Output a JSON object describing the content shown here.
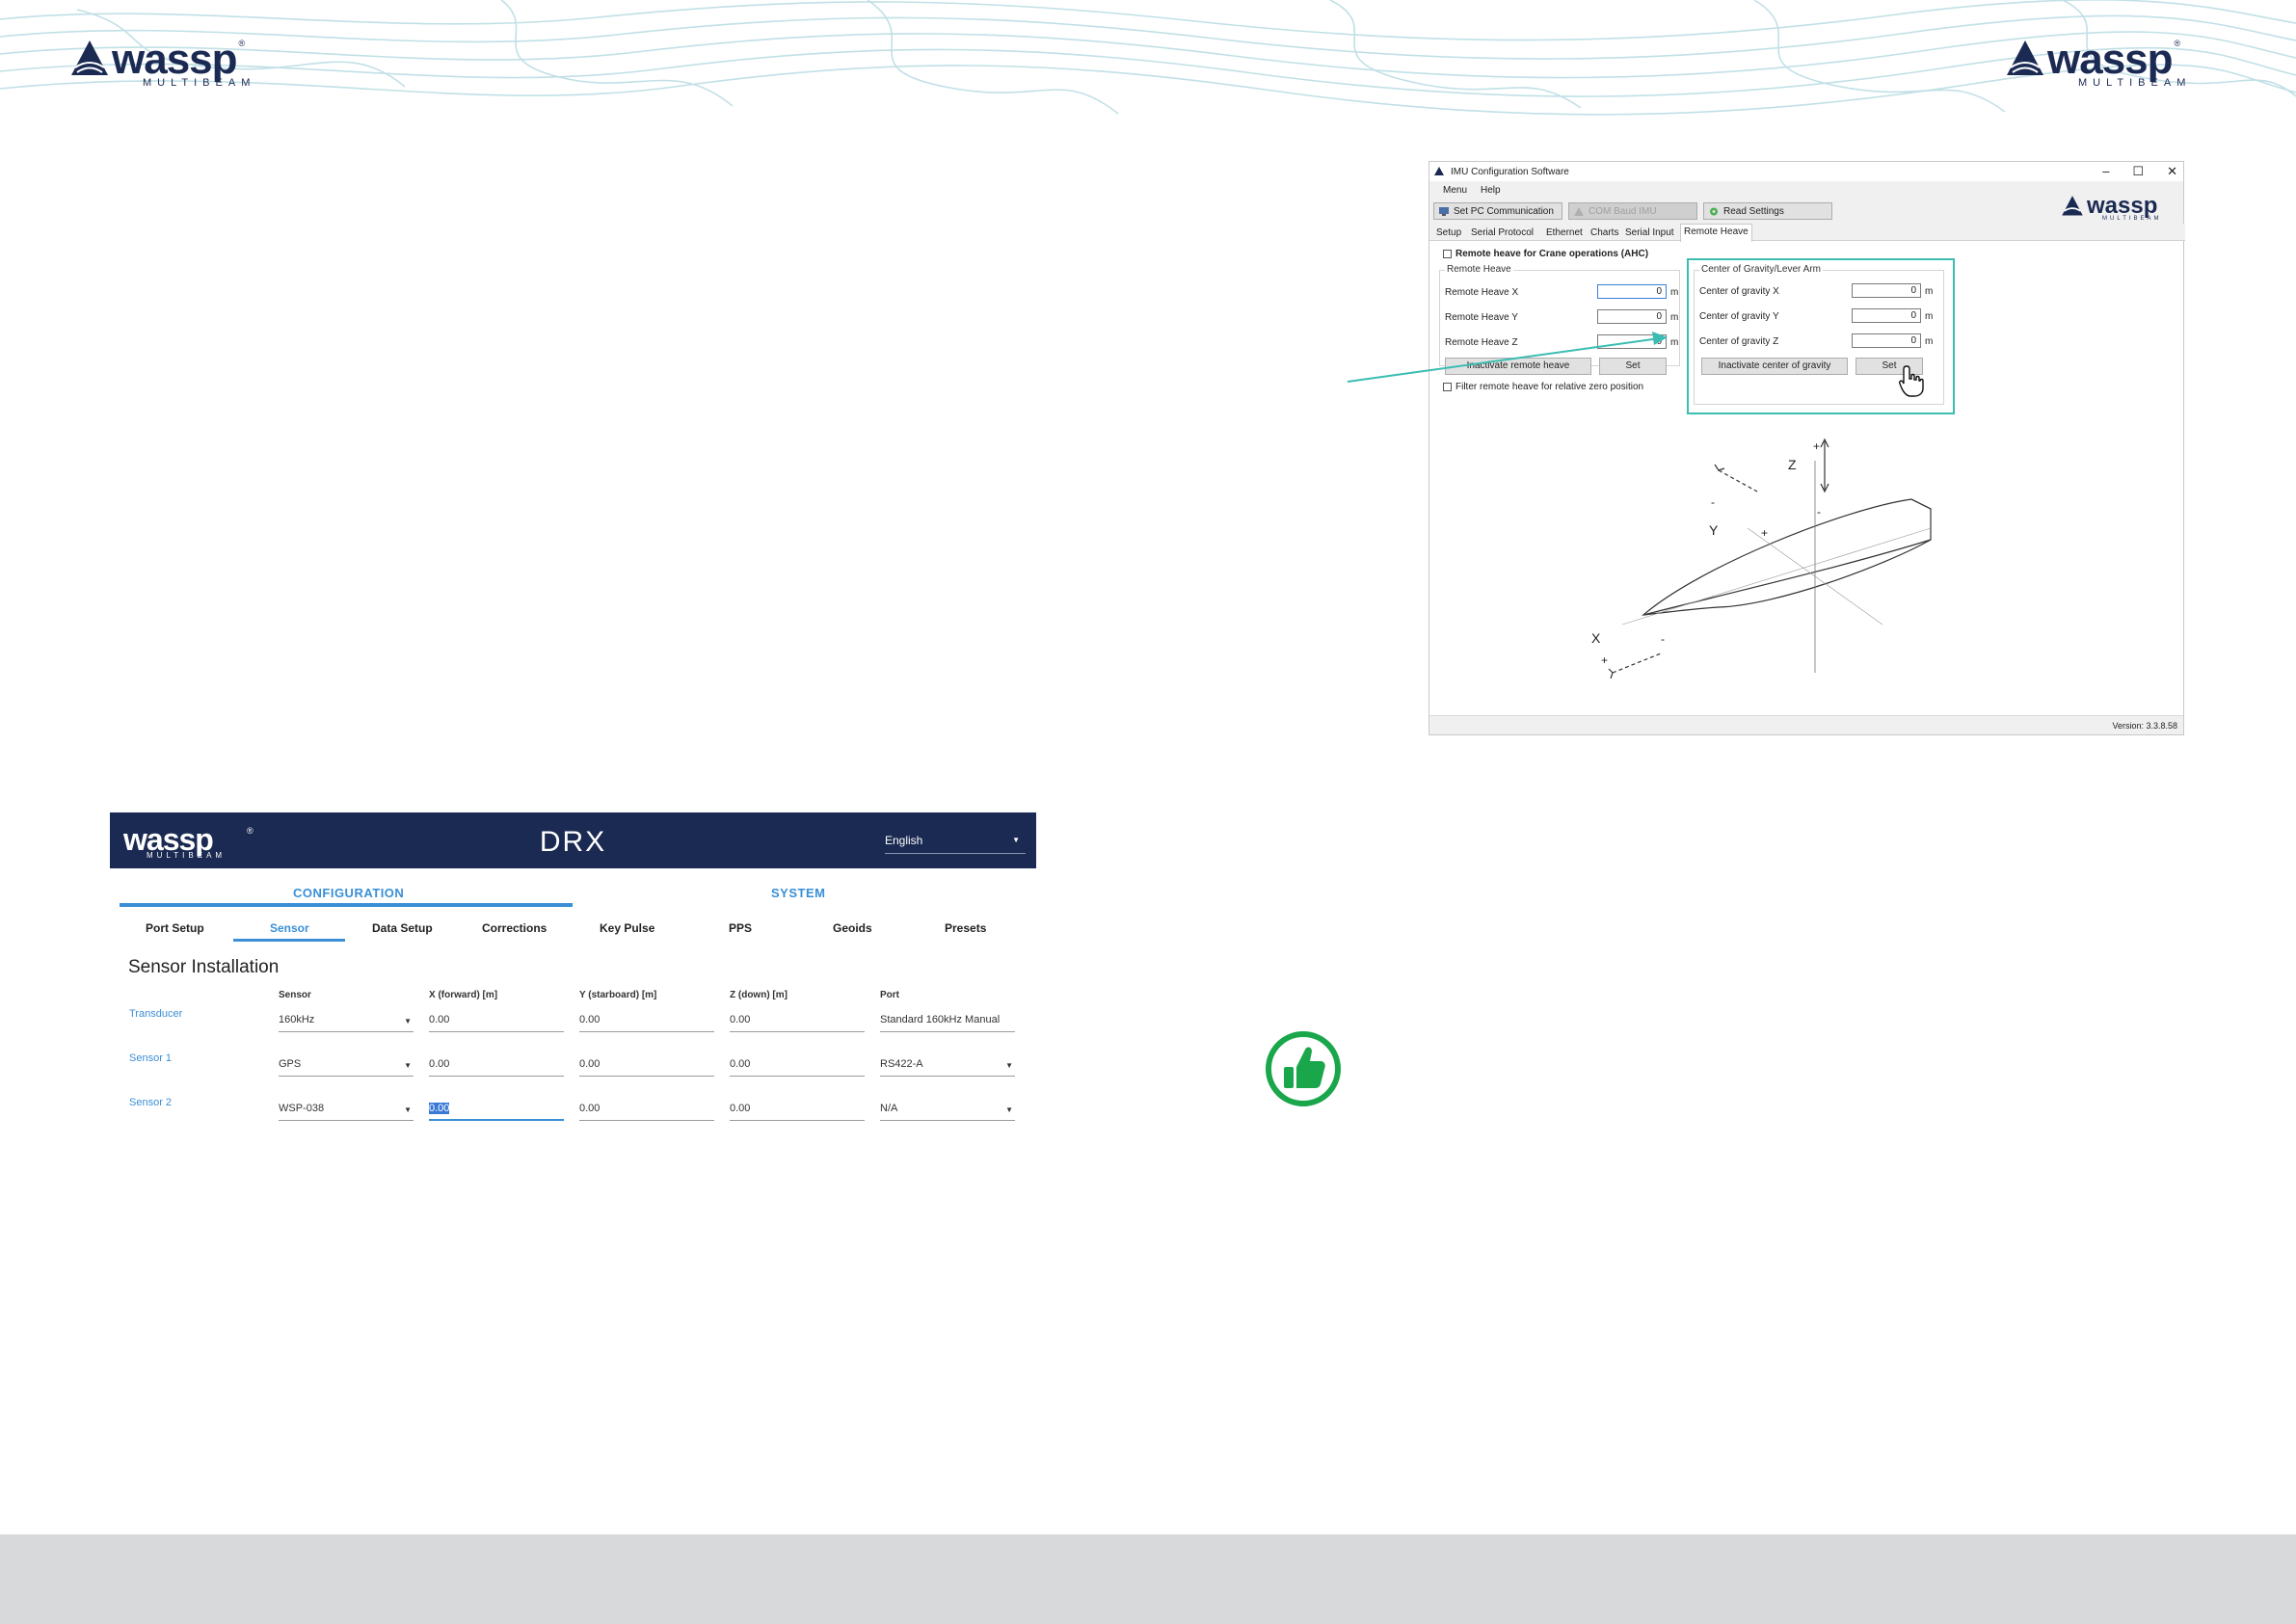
{
  "header": {
    "logo_word": "wassp",
    "logo_sub": "MULTIBEAM",
    "logo_reg": "®"
  },
  "imu_window": {
    "title": "IMU Configuration Software",
    "controls": {
      "minimize": "–",
      "maximize": "☐",
      "close": "✕"
    },
    "menu": [
      "Menu",
      "Help"
    ],
    "toolbar": {
      "set_pc": "Set PC Communication",
      "com_baud": "COM Baud IMU",
      "read_settings": "Read Settings"
    },
    "brand": {
      "word": "wassp",
      "sub": "MULTIBEAM"
    },
    "tabs": [
      "Setup",
      "Serial Protocol",
      "Ethernet",
      "Charts",
      "Serial Input",
      "Remote Heave"
    ],
    "active_tab": "Remote Heave",
    "ahc_checkbox": "Remote heave for Crane operations (AHC)",
    "remote_heave": {
      "title": "Remote Heave",
      "rows": [
        {
          "label": "Remote Heave X",
          "value": "0",
          "unit": "m"
        },
        {
          "label": "Remote Heave Y",
          "value": "0",
          "unit": "m"
        },
        {
          "label": "Remote Heave Z",
          "value": "0",
          "unit": "m"
        }
      ],
      "inactivate_button": "Inactivate remote heave",
      "set_button": "Set",
      "filter_checkbox": "Filter remote heave for relative zero position"
    },
    "center_of_gravity": {
      "title": "Center of Gravity/Lever Arm",
      "rows": [
        {
          "label": "Center of gravity X",
          "value": "0",
          "unit": "m"
        },
        {
          "label": "Center of gravity Y",
          "value": "0",
          "unit": "m"
        },
        {
          "label": "Center of gravity Z",
          "value": "0",
          "unit": "m"
        }
      ],
      "inactivate_button": "Inactivate center of gravity",
      "set_button": "Set"
    },
    "diagram": {
      "axis_z": "Z",
      "axis_y": "Y",
      "axis_x": "X",
      "plus": "+",
      "minus": "-"
    },
    "version": "Version: 3.3.8.58"
  },
  "drx": {
    "brand": {
      "word": "wassp",
      "sub": "MULTIBEAM",
      "reg": "®"
    },
    "product": "DRX",
    "language": "English",
    "sections": [
      "CONFIGURATION",
      "SYSTEM"
    ],
    "subtabs": [
      "Port Setup",
      "Sensor",
      "Data Setup",
      "Corrections",
      "Key Pulse",
      "PPS",
      "Geoids",
      "Presets"
    ],
    "active_subtab": "Sensor",
    "page_title": "Sensor Installation",
    "columns": [
      "Sensor",
      "X (forward) [m]",
      "Y (starboard) [m]",
      "Z (down) [m]",
      "Port"
    ],
    "rows": [
      {
        "name": "Transducer",
        "sensor": "160kHz",
        "x": "0.00",
        "y": "0.00",
        "z": "0.00",
        "port": "Standard 160kHz Manual"
      },
      {
        "name": "Sensor 1",
        "sensor": "GPS",
        "x": "0.00",
        "y": "0.00",
        "z": "0.00",
        "port": "RS422-A"
      },
      {
        "name": "Sensor 2",
        "sensor": "WSP-038",
        "x": "0.00",
        "y": "0.00",
        "z": "0.00",
        "port": "N/A"
      }
    ]
  },
  "colors": {
    "navy": "#1b2a52",
    "accent_blue": "#3a8fd6",
    "teal": "#3bbdb2",
    "green": "#1aa64a",
    "footer_grey": "#d8d9da"
  }
}
